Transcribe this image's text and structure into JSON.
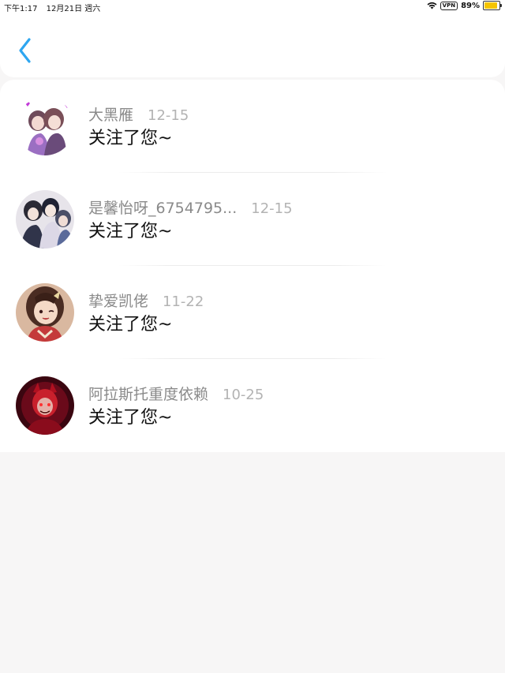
{
  "status_bar": {
    "time": "下午1:17",
    "date": "12月21日 週六",
    "vpn": "VPN",
    "battery": "89%",
    "battery_level": 0.89,
    "battery_color": "#f5c400"
  },
  "nav": {
    "back_icon": "chevron-left-icon",
    "accent": "#2ea6f0"
  },
  "notifications": [
    {
      "name": "大黑雁",
      "date": "12-15",
      "message": "关注了您~",
      "avatar": "anime-couple-avatar"
    },
    {
      "name": "是馨怡呀_6754795...",
      "date": "12-15",
      "message": "关注了您~",
      "avatar": "anime-group-avatar"
    },
    {
      "name": "挚爱凯佬",
      "date": "11-22",
      "message": "关注了您~",
      "avatar": "anime-girl-avatar"
    },
    {
      "name": "阿拉斯托重度依赖",
      "date": "10-25",
      "message": "关注了您~",
      "avatar": "red-demon-avatar"
    }
  ]
}
